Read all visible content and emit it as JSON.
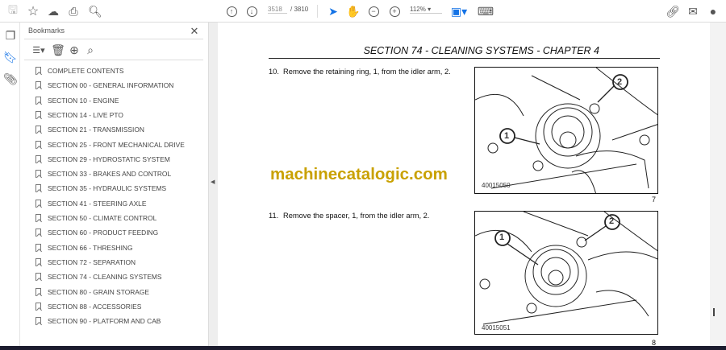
{
  "toolbar": {
    "page_current": "3518",
    "page_total": "/ 3810",
    "zoom": "112%"
  },
  "bookmarks": {
    "title": "Bookmarks",
    "items": [
      "COMPLETE CONTENTS",
      "SECTION 00 - GENERAL INFORMATION",
      "SECTION 10 - ENGINE",
      "SECTION 14 - LIVE PTO",
      "SECTION 21 - TRANSMISSION",
      "SECTION 25 - FRONT MECHANICAL DRIVE",
      "SECTION 29 - HYDROSTATIC SYSTEM",
      "SECTION 33 - BRAKES AND CONTROL",
      "SECTION 35 - HYDRAULIC SYSTEMS",
      "SECTION 41 - STEERING AXLE",
      "SECTION 50 - CLIMATE CONTROL",
      "SECTION 60 - PRODUCT FEEDING",
      "SECTION 66 - THRESHING",
      "SECTION 72 - SEPARATION",
      "SECTION 74 - CLEANING SYSTEMS",
      "SECTION 80 - GRAIN STORAGE",
      "SECTION 88 - ACCESSORIES",
      "SECTION 90 - PLATFORM AND CAB"
    ]
  },
  "document": {
    "header": "SECTION 74 - CLEANING SYSTEMS - CHAPTER 4",
    "step10_num": "10.",
    "step10": "Remove the retaining ring, 1, from the idler arm, 2.",
    "step11_num": "11.",
    "step11": "Remove the spacer, 1, from the idler arm, 2.",
    "fig1_code": "40015050",
    "fig1_num": "7",
    "fig2_code": "40015051",
    "fig2_num": "8",
    "callout1": "1",
    "callout2": "2",
    "watermark": "machinecatalogic.com"
  },
  "colors": {
    "accent": "#1473e6",
    "watermark": "#c9a100"
  }
}
